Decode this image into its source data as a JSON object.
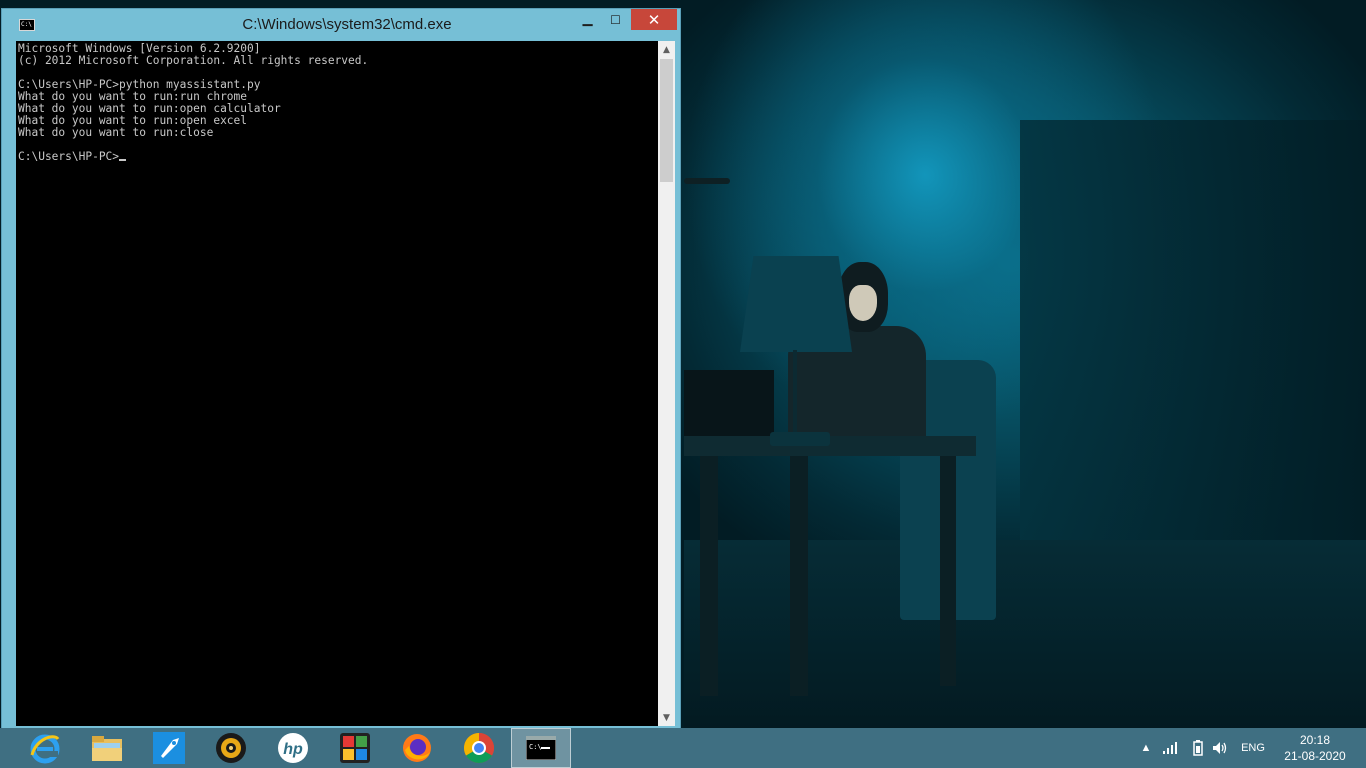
{
  "window": {
    "title": "C:\\Windows\\system32\\cmd.exe",
    "icon_label": "C:\\",
    "minimize_glyph": "▁",
    "maximize_glyph": "☐",
    "close_glyph": "✕"
  },
  "console": {
    "lines": [
      "Microsoft Windows [Version 6.2.9200]",
      "(c) 2012 Microsoft Corporation. All rights reserved.",
      "",
      "C:\\Users\\HP-PC>python myassistant.py",
      "What do you want to run:run chrome",
      "What do you want to run:open calculator",
      "What do you want to run:open excel",
      "What do you want to run:close",
      ""
    ],
    "prompt": "C:\\Users\\HP-PC>"
  },
  "taskbar": {
    "items": [
      {
        "name": "internet-explorer",
        "icon": "internet-explorer-icon"
      },
      {
        "name": "file-explorer",
        "icon": "folder-icon"
      },
      {
        "name": "app-rocket",
        "icon": "rocket-icon"
      },
      {
        "name": "media-player",
        "icon": "media-player-icon"
      },
      {
        "name": "hp",
        "icon": "hp-logo-icon"
      },
      {
        "name": "puzzle-app",
        "icon": "puzzle-icon"
      },
      {
        "name": "firefox",
        "icon": "firefox-icon"
      },
      {
        "name": "chrome",
        "icon": "chrome-icon"
      },
      {
        "name": "command-prompt",
        "icon": "cmd-icon",
        "active": true
      }
    ],
    "tray": {
      "language": "ENG",
      "time": "20:18",
      "date": "21-08-2020"
    }
  },
  "colors": {
    "taskbar": "#3f6f82",
    "window_frame": "#76bfd6",
    "close_button": "#c7473a",
    "console_bg": "#000000",
    "console_fg": "#c8c8c8"
  }
}
